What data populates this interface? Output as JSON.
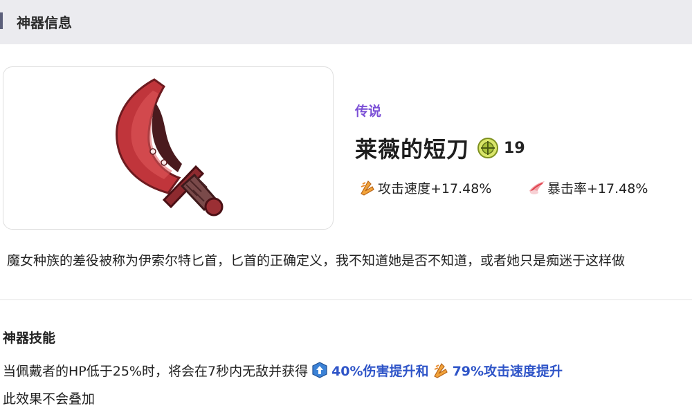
{
  "header": {
    "title": "神器信息"
  },
  "item": {
    "image_icon": "red-curved-dagger-icon",
    "rarity": "传说",
    "rarity_color": "#7b4fd6",
    "name": "莱薇的短刀",
    "level_icon": "green-crosshair-badge-icon",
    "level": "19",
    "stats": [
      {
        "icon": "attack-speed-icon",
        "label": "攻击速度+17.48%"
      },
      {
        "icon": "crit-rate-icon",
        "label": "暴击率+17.48%"
      }
    ],
    "description": "魔女种族的差役被称为伊索尔特匕首，匕首的正确定义，我不知道她是否不知道，或者她只是痴迷于这样做"
  },
  "skill": {
    "title": "神器技能",
    "text_before": "当佩戴者的HP低于25%时，将会在7秒内无敌并获得",
    "buff1_icon": "damage-up-icon",
    "buff1": "40%伤害提升和",
    "buff2_icon": "attack-speed-icon",
    "buff2": "79%攻击速度提升",
    "buff_color": "#2f55c8",
    "line2": "此效果不会叠加"
  }
}
